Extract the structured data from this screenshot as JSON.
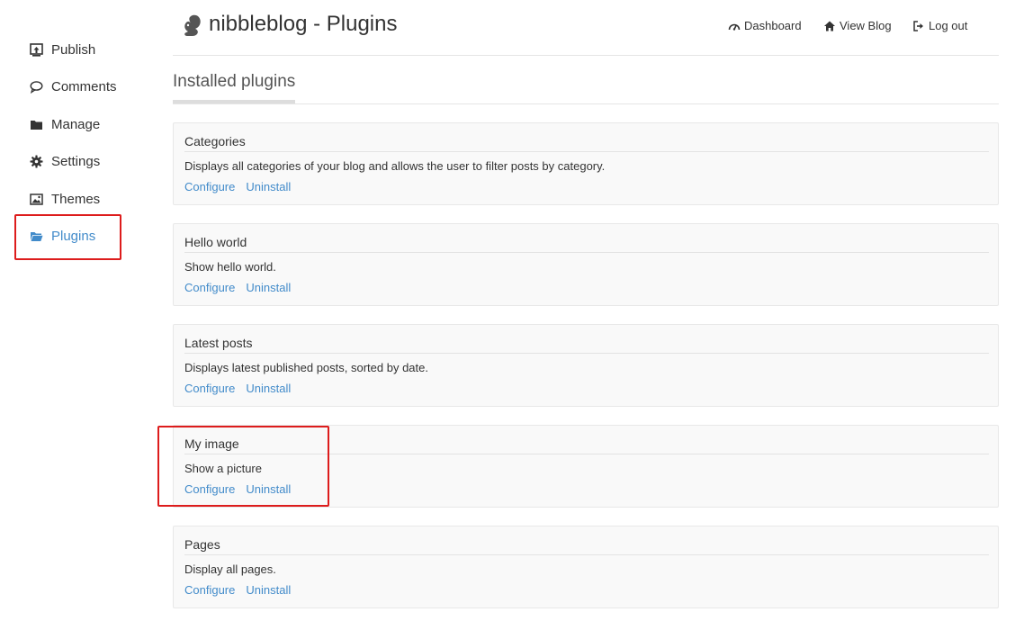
{
  "app": {
    "title": "nibbleblog - Plugins",
    "logo_icon": "squirrel-logo-icon"
  },
  "sidebar": {
    "items": [
      {
        "label": "Publish",
        "icon": "upload-icon"
      },
      {
        "label": "Comments",
        "icon": "comment-icon"
      },
      {
        "label": "Manage",
        "icon": "folder-icon"
      },
      {
        "label": "Settings",
        "icon": "gear-icon"
      },
      {
        "label": "Themes",
        "icon": "picture-icon"
      },
      {
        "label": "Plugins",
        "icon": "folder-open-icon",
        "active": true
      }
    ]
  },
  "header": {
    "links": [
      {
        "label": "Dashboard",
        "icon": "dashboard-icon"
      },
      {
        "label": "View Blog",
        "icon": "home-icon"
      },
      {
        "label": "Log out",
        "icon": "logout-icon"
      }
    ]
  },
  "section": {
    "title": "Installed plugins"
  },
  "plugins": [
    {
      "name": "Categories",
      "description": "Displays all categories of your blog and allows the user to filter posts by category.",
      "configure": "Configure",
      "uninstall": "Uninstall"
    },
    {
      "name": "Hello world",
      "description": "Show hello world.",
      "configure": "Configure",
      "uninstall": "Uninstall"
    },
    {
      "name": "Latest posts",
      "description": "Displays latest published posts, sorted by date.",
      "configure": "Configure",
      "uninstall": "Uninstall"
    },
    {
      "name": "My image",
      "description": "Show a picture",
      "configure": "Configure",
      "uninstall": "Uninstall"
    },
    {
      "name": "Pages",
      "description": "Display all pages.",
      "configure": "Configure",
      "uninstall": "Uninstall"
    }
  ],
  "colors": {
    "link": "#428bca",
    "highlight": "#dd1c1c",
    "text": "#333333",
    "card_bg": "#f9f9f9"
  }
}
